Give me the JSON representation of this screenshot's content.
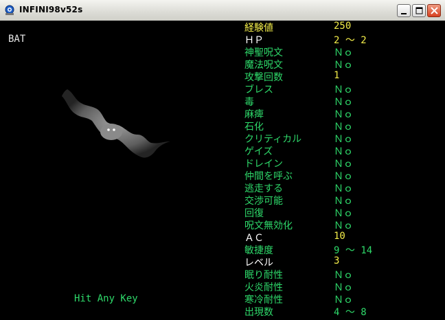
{
  "window": {
    "title": "INFINI98v52s",
    "icon": "infini-app-icon",
    "controls": [
      "minimize-icon",
      "maximize-icon",
      "close-icon"
    ]
  },
  "monster": {
    "name": "BAT",
    "image": "bat-sprite"
  },
  "prompt": "Hit Any Key",
  "stats": [
    {
      "label": "経験値",
      "value": "250",
      "label_color": "#f4ee4a",
      "value_color": "#f4ee4a"
    },
    {
      "label": "ＨＰ",
      "value": "2 ～ 2",
      "label_color": "#ffffff",
      "value_color": "#f4ee4a"
    },
    {
      "label": "神聖呪文",
      "value": "Ｎｏ"
    },
    {
      "label": "魔法呪文",
      "value": "Ｎｏ"
    },
    {
      "label": "攻撃回数",
      "value": "1",
      "value_color": "#f4ee4a"
    },
    {
      "label": "ブレス",
      "value": "Ｎｏ"
    },
    {
      "label": "毒",
      "value": "Ｎｏ"
    },
    {
      "label": "麻痺",
      "value": "Ｎｏ"
    },
    {
      "label": "石化",
      "value": "Ｎｏ"
    },
    {
      "label": "クリティカル",
      "value": "Ｎｏ"
    },
    {
      "label": "ゲイズ",
      "value": "Ｎｏ"
    },
    {
      "label": "ドレイン",
      "value": "Ｎｏ"
    },
    {
      "label": "仲間を呼ぶ",
      "value": "Ｎｏ"
    },
    {
      "label": "逃走する",
      "value": "Ｎｏ"
    },
    {
      "label": "交渉可能",
      "value": "Ｎｏ"
    },
    {
      "label": "回復",
      "value": "Ｎｏ"
    },
    {
      "label": "呪文無効化",
      "value": "Ｎｏ"
    },
    {
      "label": "ＡＣ",
      "value": "10",
      "label_color": "#ffffff",
      "value_color": "#f4ee4a"
    },
    {
      "label": "敏捷度",
      "value": "9 ～ 14"
    },
    {
      "label": "レベル",
      "value": "3",
      "label_color": "#ffffff",
      "value_color": "#f4ee4a"
    },
    {
      "label": "眠り耐性",
      "value": "Ｎｏ"
    },
    {
      "label": "火炎耐性",
      "value": "Ｎｏ"
    },
    {
      "label": "寒冷耐性",
      "value": "Ｎｏ"
    },
    {
      "label": "出現数",
      "value": "4 ～ 8"
    }
  ]
}
